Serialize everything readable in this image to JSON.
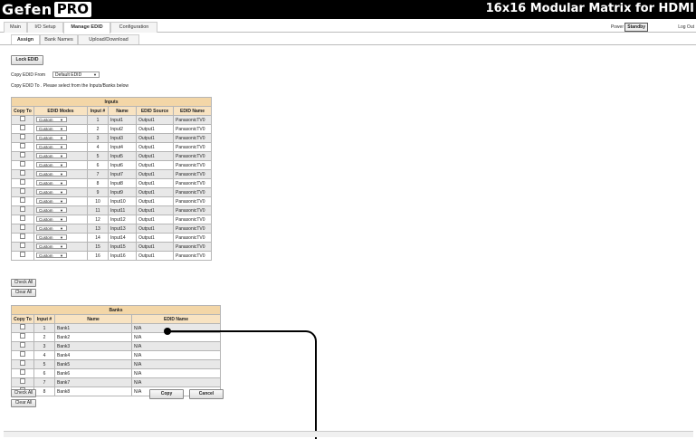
{
  "header": {
    "logo_left": "Gefen",
    "logo_right": "PRO",
    "product_title": "16x16 Modular Matrix for HDMI",
    "power_label": "Power",
    "standby_label": "Standby",
    "logout_label": "Log Out"
  },
  "nav": {
    "tabs": [
      "Main",
      "I/O Setup",
      "Manage EDID",
      "Configuration"
    ],
    "active": "Manage EDID"
  },
  "subnav": {
    "tabs": [
      "Assign",
      "Bank Names",
      "Upload/Download"
    ],
    "active": "Assign"
  },
  "controls": {
    "lock_button": "Lock EDID",
    "copy_from_label": "Copy EDID From",
    "copy_from_value": "Default EDID",
    "copy_to_label": "Copy EDID To . Please select from the Inputs/Banks below",
    "check_all": "Check All",
    "clear_all": "Clear All",
    "copy_button": "Copy",
    "cancel_button": "Cancel"
  },
  "inputs_table": {
    "title": "Inputs",
    "columns": [
      "Copy To",
      "EDID Modes",
      "Input #",
      "Name",
      "EDID Source",
      "EDID Name"
    ],
    "rows": [
      {
        "mode": "Custom",
        "num": "1",
        "name": "Input1",
        "source": "Output1",
        "edid": "PanasonicTV0"
      },
      {
        "mode": "Custom",
        "num": "2",
        "name": "Input2",
        "source": "Output1",
        "edid": "PanasonicTV0"
      },
      {
        "mode": "Custom",
        "num": "3",
        "name": "Input3",
        "source": "Output1",
        "edid": "PanasonicTV0"
      },
      {
        "mode": "Custom",
        "num": "4",
        "name": "Input4",
        "source": "Output1",
        "edid": "PanasonicTV0"
      },
      {
        "mode": "Custom",
        "num": "5",
        "name": "Input5",
        "source": "Output1",
        "edid": "PanasonicTV0"
      },
      {
        "mode": "Custom",
        "num": "6",
        "name": "Input6",
        "source": "Output1",
        "edid": "PanasonicTV0"
      },
      {
        "mode": "Custom",
        "num": "7",
        "name": "Input7",
        "source": "Output1",
        "edid": "PanasonicTV0"
      },
      {
        "mode": "Custom",
        "num": "8",
        "name": "Input8",
        "source": "Output1",
        "edid": "PanasonicTV0"
      },
      {
        "mode": "Custom",
        "num": "9",
        "name": "Input9",
        "source": "Output1",
        "edid": "PanasonicTV0"
      },
      {
        "mode": "Custom",
        "num": "10",
        "name": "Input10",
        "source": "Output1",
        "edid": "PanasonicTV0"
      },
      {
        "mode": "Custom",
        "num": "11",
        "name": "Input11",
        "source": "Output1",
        "edid": "PanasonicTV0"
      },
      {
        "mode": "Custom",
        "num": "12",
        "name": "Input12",
        "source": "Output1",
        "edid": "PanasonicTV0"
      },
      {
        "mode": "Custom",
        "num": "13",
        "name": "Input13",
        "source": "Output1",
        "edid": "PanasonicTV0"
      },
      {
        "mode": "Custom",
        "num": "14",
        "name": "Input14",
        "source": "Output1",
        "edid": "PanasonicTV0"
      },
      {
        "mode": "Custom",
        "num": "15",
        "name": "Input15",
        "source": "Output1",
        "edid": "PanasonicTV0"
      },
      {
        "mode": "Custom",
        "num": "16",
        "name": "Input16",
        "source": "Output1",
        "edid": "PanasonicTV0"
      }
    ]
  },
  "banks_table": {
    "title": "Banks",
    "columns": [
      "Copy To",
      "Input #",
      "Name",
      "EDID Name"
    ],
    "rows": [
      {
        "num": "1",
        "name": "Bank1",
        "edid": "N/A"
      },
      {
        "num": "2",
        "name": "Bank2",
        "edid": "N/A"
      },
      {
        "num": "3",
        "name": "Bank3",
        "edid": "N/A"
      },
      {
        "num": "4",
        "name": "Bank4",
        "edid": "N/A"
      },
      {
        "num": "5",
        "name": "Bank5",
        "edid": "N/A"
      },
      {
        "num": "6",
        "name": "Bank6",
        "edid": "N/A"
      },
      {
        "num": "7",
        "name": "Bank7",
        "edid": "N/A"
      },
      {
        "num": "8",
        "name": "Bank8",
        "edid": "N/A"
      }
    ]
  }
}
